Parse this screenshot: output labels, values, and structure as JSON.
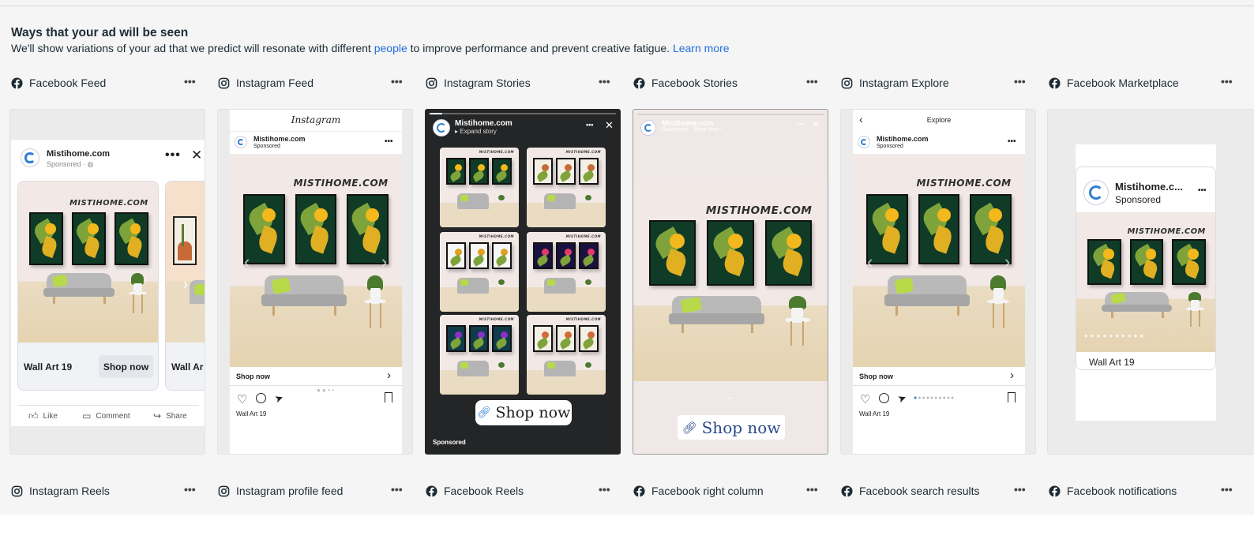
{
  "header": {
    "title": "Ways that your ad will be seen",
    "desc_before": "We'll show variations of your ad that we predict will resonate with different ",
    "desc_link1": "people",
    "desc_after": " to improve performance and prevent creative fatigue. ",
    "desc_link2": "Learn more"
  },
  "placements_top": [
    {
      "platform": "facebook",
      "label": "Facebook Feed"
    },
    {
      "platform": "instagram",
      "label": "Instagram Feed"
    },
    {
      "platform": "instagram",
      "label": "Instagram Stories"
    },
    {
      "platform": "facebook",
      "label": "Facebook Stories"
    },
    {
      "platform": "instagram",
      "label": "Instagram Explore"
    },
    {
      "platform": "facebook",
      "label": "Facebook Marketplace"
    }
  ],
  "placements_bottom": [
    {
      "platform": "instagram",
      "label": "Instagram Reels"
    },
    {
      "platform": "instagram",
      "label": "Instagram profile feed"
    },
    {
      "platform": "facebook",
      "label": "Facebook Reels"
    },
    {
      "platform": "facebook",
      "label": "Facebook right column"
    },
    {
      "platform": "facebook",
      "label": "Facebook search results"
    },
    {
      "platform": "facebook",
      "label": "Facebook notifications"
    }
  ],
  "more_label": "•••",
  "ad": {
    "page_name": "Mistihome.com",
    "page_name_short": "Mistihome.c...",
    "sponsored": "Sponsored",
    "sponsored_dot": "Sponsored · ",
    "product": "Wall Art 19",
    "product_short": "Wall Ar",
    "cta": "Shop now",
    "brand_mark": "MISTIHOME.COM",
    "expand_story": "▸ Expand story",
    "story_sub": "Sponsored · Shop Now ›"
  },
  "fb_feed": {
    "like": "Like",
    "comment": "Comment",
    "share": "Share"
  },
  "ig_feed": {
    "logo": "Instagram"
  },
  "ig_explore": {
    "title": "Explore"
  },
  "colors": {
    "facebook": "#1c2b33",
    "link": "#216fdb",
    "accent_blue": "#2e7fd1",
    "frame_green": "#0f3b27",
    "sun": "#f3b81b",
    "pillow": "#b7d94a"
  }
}
